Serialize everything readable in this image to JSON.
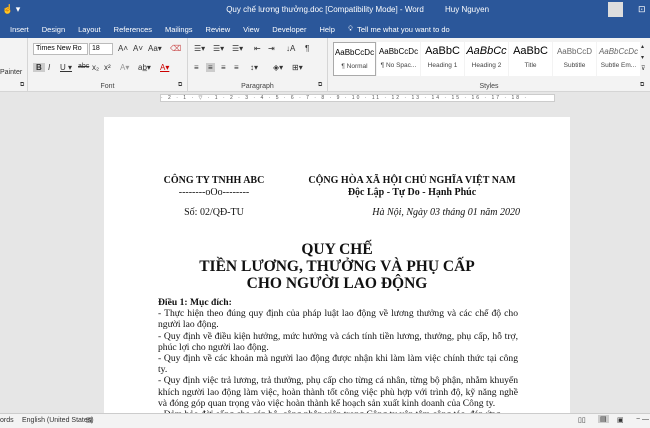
{
  "window": {
    "title": "Quy chế lương thưởng.doc [Compatibility Mode]  -  Word",
    "user": "Huy Nguyen"
  },
  "tabs": [
    "Insert",
    "Design",
    "Layout",
    "References",
    "Mailings",
    "Review",
    "View",
    "Developer",
    "Help",
    "Tell me what you want to do"
  ],
  "ribbon": {
    "painter": "Painter",
    "font_name": "Times New Ro",
    "font_size": "18",
    "font_group": "Font",
    "paragraph_group": "Paragraph",
    "styles_group": "Styles",
    "styles": [
      {
        "preview": "AaBbCcDc",
        "name": "¶ Normal"
      },
      {
        "preview": "AaBbCcDc",
        "name": "¶ No Spac..."
      },
      {
        "preview": "AaBbC",
        "name": "Heading 1"
      },
      {
        "preview": "AaBbCc",
        "name": "Heading 2"
      },
      {
        "preview": "AaBbC",
        "name": "Title"
      },
      {
        "preview": "AaBbCcD",
        "name": "Subtitle"
      },
      {
        "preview": "AaBbCcDc",
        "name": "Subtle Em..."
      }
    ]
  },
  "ruler": "· 2 · 1 · ▽ · 1 · 2 · 3 · 4 · 5 · 6 · 7 · 8 · 9 · 10 · 11 · 12 · 13 · 14 · 15 · 16 · 17 · 18 ·",
  "document": {
    "company": "CÔNG TY TNHH ABC",
    "company_sep": "--------oOo--------",
    "nation": "CỘNG HÒA XÃ HỘI CHỦ NGHĨA VIỆT NAM",
    "motto": "Độc Lập - Tự Do - Hạnh Phúc",
    "number": "Số: 02/QĐ-TU",
    "date": "Hà Nội, Ngày 03 tháng 01 năm 2020",
    "title": [
      "QUY CHẾ",
      "TIỀN LƯƠNG, THƯỞNG VÀ PHỤ CẤP",
      "CHO NGƯỜI LAO ĐỘNG"
    ],
    "article": "Điều 1: Mục đích:",
    "paragraphs": [
      "- Thực hiện theo đúng quy định của pháp luật lao động về lương thưởng và các chế độ cho người lao động.",
      "- Quy định về điều kiện hưởng, mức hưởng và cách tính tiền lương, thưởng, phụ cấp, hỗ trợ, phúc lợi cho người lao động.",
      "- Quy định về các khoản mà người lao động được nhận khi làm làm việc chính thức tại công ty.",
      "- Quy định việc trả lương, trả thưởng, phụ cấp cho từng cá nhân, từng bộ phận, nhằm khuyến khích người lao động làm việc, hoàn thành tốt công việc phù hợp với trình độ, kỹ năng nghề và đóng góp quan trọng vào việc hoàn thành kế hoạch sản xuất kinh doanh của Công ty.",
      "- Đảm bảo đời sống cho cán bộ, công nhân viên trong Công ty yên tâm công tác, đáp ứng"
    ]
  },
  "status": {
    "words": "ords",
    "language": "English (United States)"
  }
}
